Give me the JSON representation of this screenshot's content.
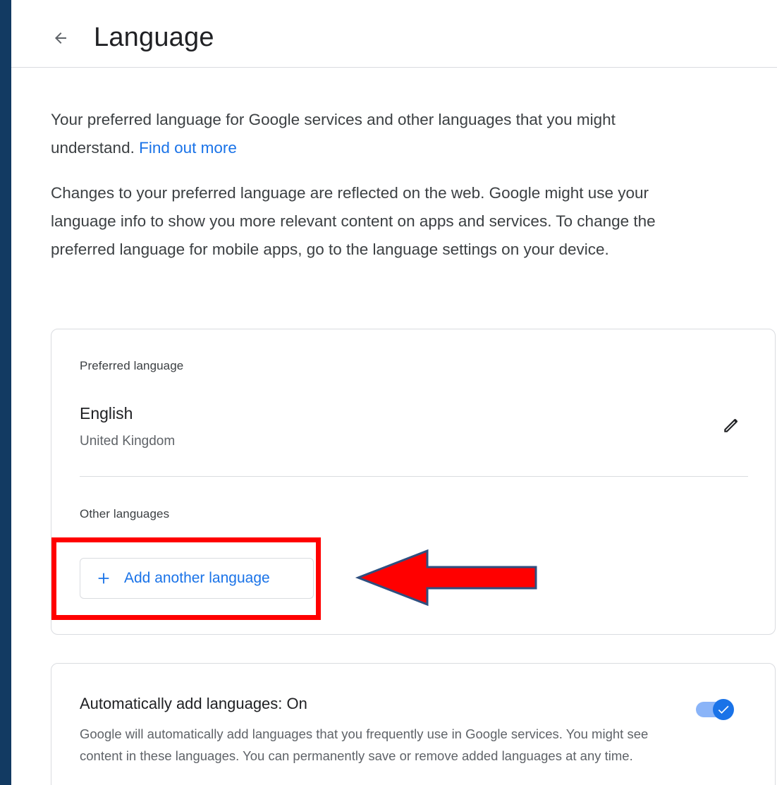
{
  "header": {
    "title": "Language",
    "back_icon": "arrow-back-icon"
  },
  "intro": {
    "text": "Your preferred language for Google services and other languages that you might understand.",
    "link_text": "Find out more"
  },
  "notice": {
    "text": "Changes to your preferred language are reflected on the web. Google might use your language info to show you more relevant content on apps and ser­vices. To change the preferred language for mobile apps, go to the lan­guage settings on your device."
  },
  "languages_card": {
    "preferred_label": "Preferred language",
    "preferred": {
      "name": "English",
      "region": "United Kingdom",
      "edit_icon": "pencil-icon"
    },
    "other_label": "Other languages",
    "add_button_label": "Add another language",
    "add_icon": "plus-icon"
  },
  "auto_card": {
    "title": "Automatically add languages: On",
    "description": "Google will automatically add languages that you frequently use in Google ser­vices. You might see content in these languages. You can permanently save or remove added languages at any time.",
    "toggle_state": "on"
  },
  "annotation": {
    "highlight_color": "#ff0000",
    "arrow_color": "#ff0000"
  },
  "colors": {
    "accent": "#1a73e8",
    "frame": "#123a62"
  }
}
